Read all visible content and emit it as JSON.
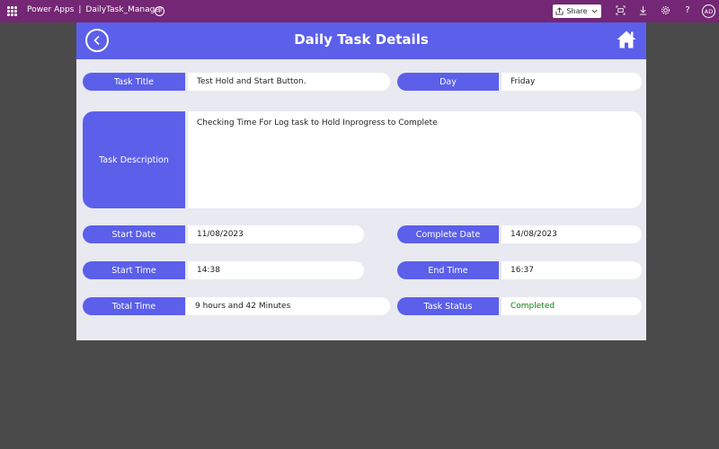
{
  "topbar": {
    "product": "Power Apps",
    "separator": "|",
    "app_name": "DailyTask_Manager",
    "info_glyph": "i",
    "share_label": "Share",
    "help_glyph": "?",
    "avatar_initials": "AD",
    "icons": [
      "waffle-icon",
      "info-icon",
      "share-icon",
      "chevron-down-icon",
      "fit-screen-icon",
      "download-icon",
      "settings-icon",
      "help-icon"
    ]
  },
  "header": {
    "title": "Daily Task Details",
    "icons": [
      "back-arrow-icon",
      "home-icon"
    ]
  },
  "fields": {
    "task_title": {
      "label": "Task Title",
      "value": "Test Hold and Start Button."
    },
    "day": {
      "label": "Day",
      "value": "Friday"
    },
    "task_description": {
      "label": "Task Description",
      "value": "Checking Time For Log task to Hold Inprogress to Complete"
    },
    "start_date": {
      "label": "Start Date",
      "value": "11/08/2023"
    },
    "complete_date": {
      "label": "Complete Date",
      "value": "14/08/2023"
    },
    "start_time": {
      "label": "Start Time",
      "value": "14:38"
    },
    "end_time": {
      "label": "End Time",
      "value": "16:37"
    },
    "total_time": {
      "label": "Total Time",
      "value": "9 hours and 42 Minutes"
    },
    "task_status": {
      "label": "Task Status",
      "value": "Completed"
    }
  },
  "colors": {
    "topbar": "#742774",
    "accent": "#5b5fea",
    "canvas_bg": "#e9e9f1",
    "status_completed": "#107c10"
  }
}
